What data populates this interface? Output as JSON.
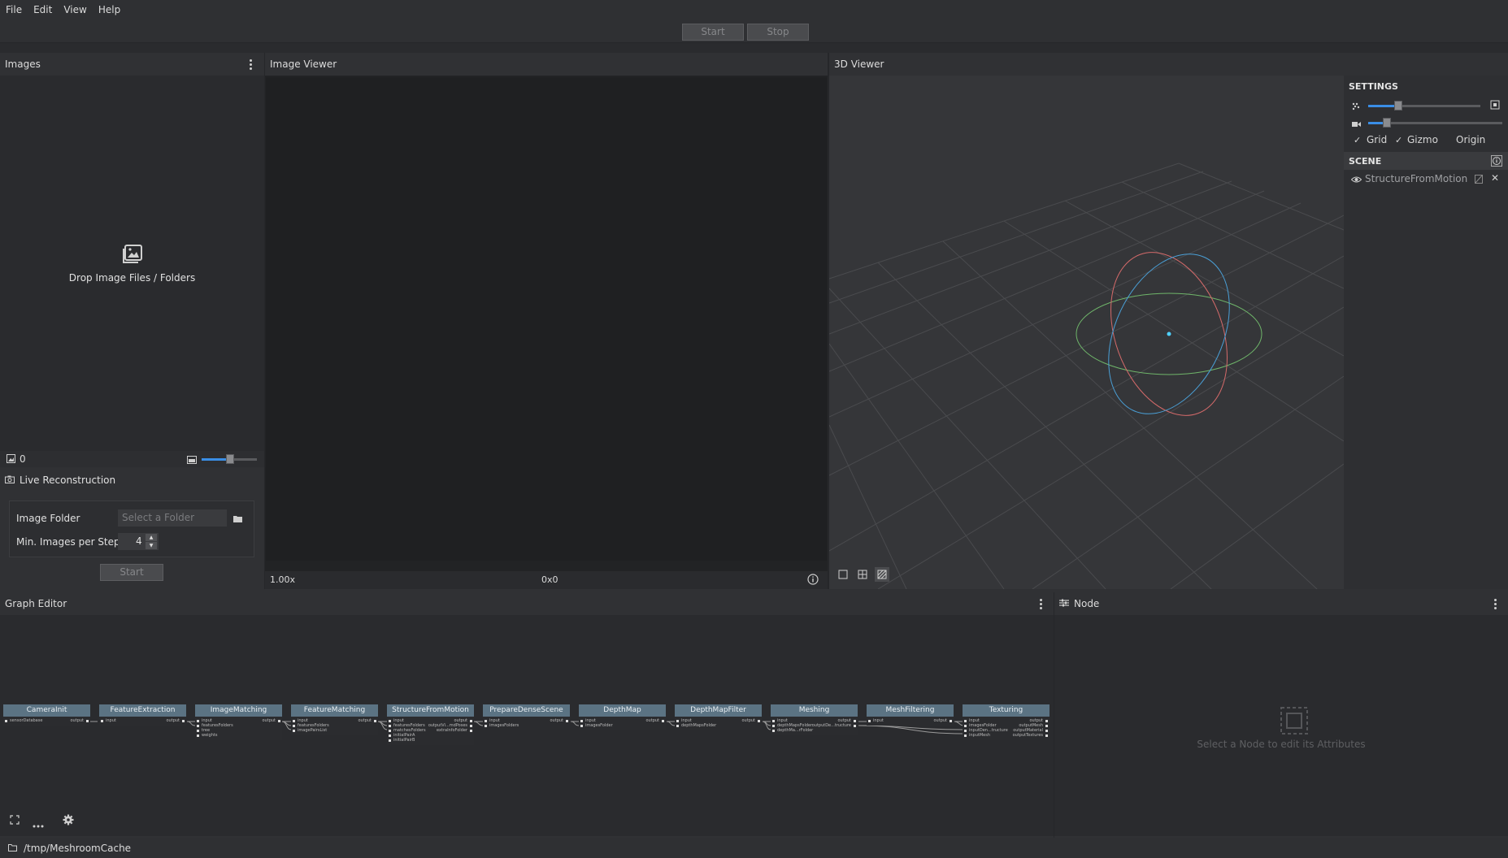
{
  "menu": [
    "File",
    "Edit",
    "View",
    "Help"
  ],
  "toolbar": {
    "start_label": "Start",
    "stop_label": "Stop"
  },
  "images_panel": {
    "title": "Images",
    "drop_text": "Drop Image Files / Folders",
    "count": "0"
  },
  "live": {
    "title": "Live Reconstruction",
    "image_folder_label": "Image Folder",
    "folder_placeholder": "Select a Folder",
    "min_images_label": "Min. Images per Step",
    "min_images_value": "4",
    "start_label": "Start"
  },
  "image_viewer": {
    "title": "Image Viewer",
    "zoom": "1.00x",
    "resolution": "0x0"
  },
  "viewer3d": {
    "title": "3D Viewer",
    "settings_title": "SETTINGS",
    "grid_label": "Grid",
    "gizmo_label": "Gizmo",
    "origin_label": "Origin",
    "scene_title": "SCENE",
    "scene_item": "StructureFromMotion"
  },
  "graph_editor": {
    "title": "Graph Editor",
    "nodes": [
      {
        "title": "CameraInit",
        "inputs": [
          "sensorDatabase"
        ],
        "outputs": [
          "output"
        ]
      },
      {
        "title": "FeatureExtraction",
        "inputs": [
          "input"
        ],
        "outputs": [
          "output"
        ]
      },
      {
        "title": "ImageMatching",
        "inputs": [
          "input",
          "featuresFolders",
          "tree",
          "weights"
        ],
        "outputs": [
          "output"
        ]
      },
      {
        "title": "FeatureMatching",
        "inputs": [
          "input",
          "featuresFolders",
          "imagePairsList"
        ],
        "outputs": [
          "output"
        ]
      },
      {
        "title": "StructureFromMotion",
        "inputs": [
          "input",
          "featuresFolders",
          "matchesFolders",
          "initialPairA",
          "initialPairB"
        ],
        "outputs": [
          "output",
          "outputVi...mdPoses",
          "extraInfoFolder"
        ]
      },
      {
        "title": "PrepareDenseScene",
        "inputs": [
          "input",
          "imagesFolders"
        ],
        "outputs": [
          "output"
        ]
      },
      {
        "title": "DepthMap",
        "inputs": [
          "input",
          "imagesFolder"
        ],
        "outputs": [
          "output"
        ]
      },
      {
        "title": "DepthMapFilter",
        "inputs": [
          "input",
          "depthMapsFolder"
        ],
        "outputs": [
          "output"
        ]
      },
      {
        "title": "Meshing",
        "inputs": [
          "input",
          "depthMapsFolder",
          "depthMa...rFolder"
        ],
        "outputs": [
          "output",
          "outputDe...tructure"
        ]
      },
      {
        "title": "MeshFiltering",
        "inputs": [
          "input"
        ],
        "outputs": [
          "output"
        ]
      },
      {
        "title": "Texturing",
        "inputs": [
          "input",
          "imagesFolder",
          "inputDen...tructure",
          "inputMesh"
        ],
        "outputs": [
          "output",
          "outputMesh",
          "outputMaterial",
          "outputTextures"
        ]
      }
    ]
  },
  "node_panel": {
    "title": "Node",
    "hint": "Select a Node to edit its Attributes"
  },
  "status": {
    "path": "/tmp/MeshroomCache"
  }
}
